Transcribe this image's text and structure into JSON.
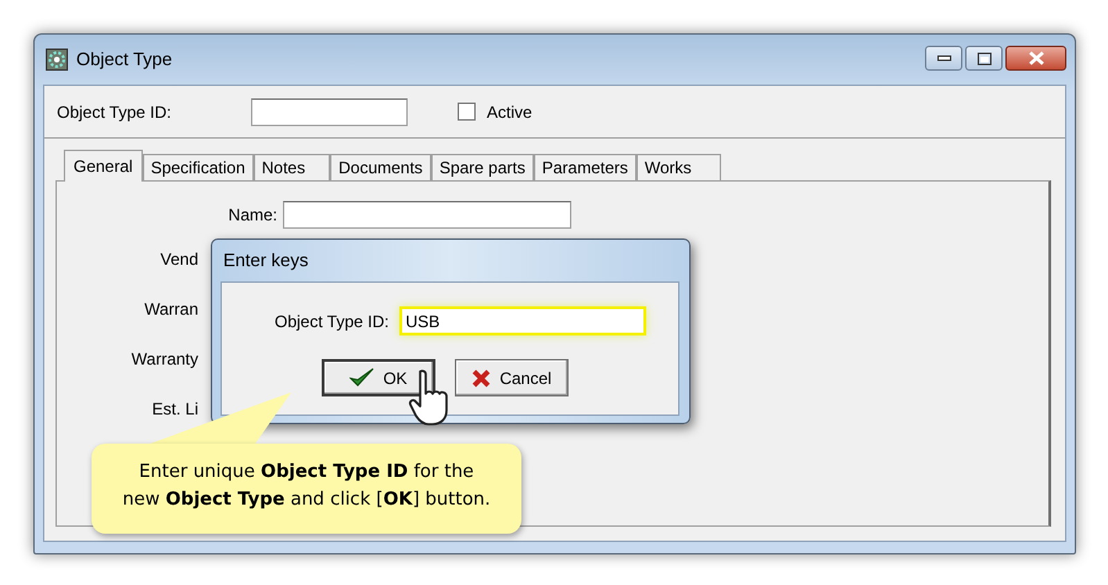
{
  "window": {
    "title": "Object Type"
  },
  "header": {
    "id_label": "Object Type ID:",
    "active": {
      "label": "Active",
      "checked": false
    }
  },
  "tabs": [
    {
      "label": "General",
      "selected": true
    },
    {
      "label": "Specification",
      "selected": false
    },
    {
      "label": "Notes",
      "selected": false
    },
    {
      "label": "Documents",
      "selected": false
    },
    {
      "label": "Spare parts",
      "selected": false
    },
    {
      "label": "Parameters",
      "selected": false
    },
    {
      "label": "Works",
      "selected": false
    }
  ],
  "form": [
    {
      "label": "Name:",
      "kind": "field"
    },
    {
      "label": "Vend",
      "kind": "label"
    },
    {
      "label": "Warran",
      "kind": "label"
    },
    {
      "label": "Warranty",
      "kind": "label"
    },
    {
      "label": "Est. Li",
      "kind": "label"
    }
  ],
  "dialog": {
    "title": "Enter keys",
    "field_label": "Object Type ID:",
    "field_value": "USB",
    "focused": true,
    "buttons": [
      {
        "label": "OK",
        "kind": "ok"
      },
      {
        "label": "Cancel",
        "kind": "cancel"
      }
    ]
  },
  "callout": {
    "text": "Enter unique **Object Type ID** for the\nnew **Object Type** and click [**OK**] button."
  }
}
